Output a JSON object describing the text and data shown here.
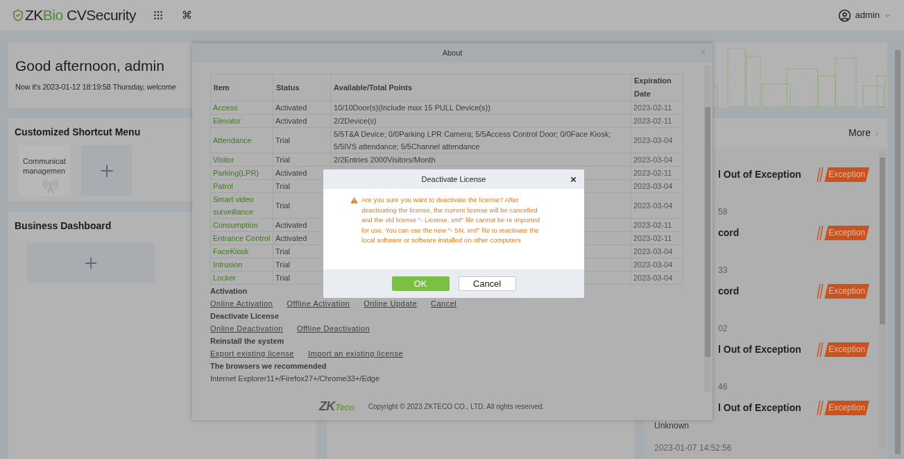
{
  "top_bar": {
    "brand": {
      "prefix": "ZK",
      "accent": "Bio",
      "name": "CVSecurity"
    },
    "command_glyph": "⌘",
    "user": "admin"
  },
  "greeting": {
    "title": "Good afternoon, admin",
    "subtitle": "Now it's 2023-01-12 18:19:58 Thursday, welcome"
  },
  "shortcut_menu": {
    "title": "Customized Shortcut Menu",
    "tiles": [
      {
        "kind": "module",
        "label": "Communicat managemen"
      },
      {
        "kind": "add"
      }
    ]
  },
  "business_dashboard": {
    "title": "Business Dashboard"
  },
  "events": {
    "more": "More",
    "items": [
      {
        "kind": "covered",
        "title": "l Out of Exception",
        "badge": "Exception",
        "time": "58"
      },
      {
        "kind": "covered",
        "title": "cord",
        "badge": "Exception",
        "time": "33"
      },
      {
        "kind": "covered",
        "title": "cord",
        "badge": "Exception",
        "time": "02"
      },
      {
        "kind": "covered",
        "title": "l Out of Exception",
        "badge": "Exception",
        "time": "46"
      },
      {
        "kind": "visible",
        "title": "l Out of Exception",
        "badge": "Exception",
        "subtitle": "Unknown",
        "time": "2023-01-07 14:52:56"
      }
    ]
  },
  "about_dialog": {
    "title": "About",
    "table": {
      "columns": [
        "Item",
        "Status",
        "Available/Total Points",
        "Expiration Date"
      ],
      "rows": [
        {
          "item": "Access",
          "status": "Activated",
          "points": "10/10Door(s)(Include max 15 PULL Device(s))",
          "expires": "2023-02-11"
        },
        {
          "item": "Elevator",
          "status": "Activated",
          "points": "2/2Device(s)",
          "expires": "2023-02-11"
        },
        {
          "item": "Attendance",
          "status": "Trial",
          "points": "5/5T&A Device; 0/0Parking LPR Camera; 5/5Access Control Door; 0/0Face Kiosk; 5/5IVS attendance; 5/5Channel attendance",
          "expires": "2023-03-04"
        },
        {
          "item": "Visitor",
          "status": "Trial",
          "points": "2/2Entries 2000Visitors/Month",
          "expires": "2023-03-04"
        },
        {
          "item": "Parking(LPR)",
          "status": "Activated",
          "expires": "2023-02-11"
        },
        {
          "item": "Patrol",
          "status": "Trial",
          "expires": "2023-03-04"
        },
        {
          "item": "Smart video surveillance",
          "status": "Trial",
          "expires": "2023-03-04"
        },
        {
          "item": "Consumption",
          "status": "Activated",
          "expires": "2023-02-11"
        },
        {
          "item": "Entrance Control",
          "status": "Activated",
          "expires": "2023-02-11"
        },
        {
          "item": "FaceKiosk",
          "status": "Trial",
          "expires": "2023-03-04"
        },
        {
          "item": "Intrusion",
          "status": "Trial",
          "expires": "2023-03-04"
        },
        {
          "item": "Locker",
          "status": "Trial",
          "expires": "2023-03-04"
        }
      ]
    },
    "sections": [
      {
        "heading": "Activation",
        "links": [
          "Online Activation",
          "Offline Activation",
          "Online Update",
          "Cancel"
        ]
      },
      {
        "heading": "Deactivate License",
        "links": [
          "Online Deactivation",
          "Offline Deactivation"
        ]
      },
      {
        "heading": "Reinstall the system",
        "links": [
          "Export existing license",
          "Import an existing license"
        ]
      },
      {
        "heading": "The browsers we recommended",
        "text": "Internet Explorer11+/Firefox27+/Chrome33+/Edge"
      }
    ],
    "footer": {
      "logo": {
        "prefix": "ZK",
        "accent": "Teco"
      },
      "copyright": "Copyright © 2023 ZKTECO CO., LTD. All rights reserved."
    }
  },
  "confirm_dialog": {
    "title": "Deactivate License",
    "message": "Are you sure you want to deactivate the license? After deactivating the license, the current license will be cancelled and the old license \"- License. xml\" file cannot be re imported for use. You can use the new \"- SN. xml\" file to reactivate the local software or software installed on other computers",
    "buttons": [
      {
        "kind": "primary",
        "label": "OK"
      },
      {
        "kind": "secondary",
        "label": "Cancel"
      }
    ]
  }
}
